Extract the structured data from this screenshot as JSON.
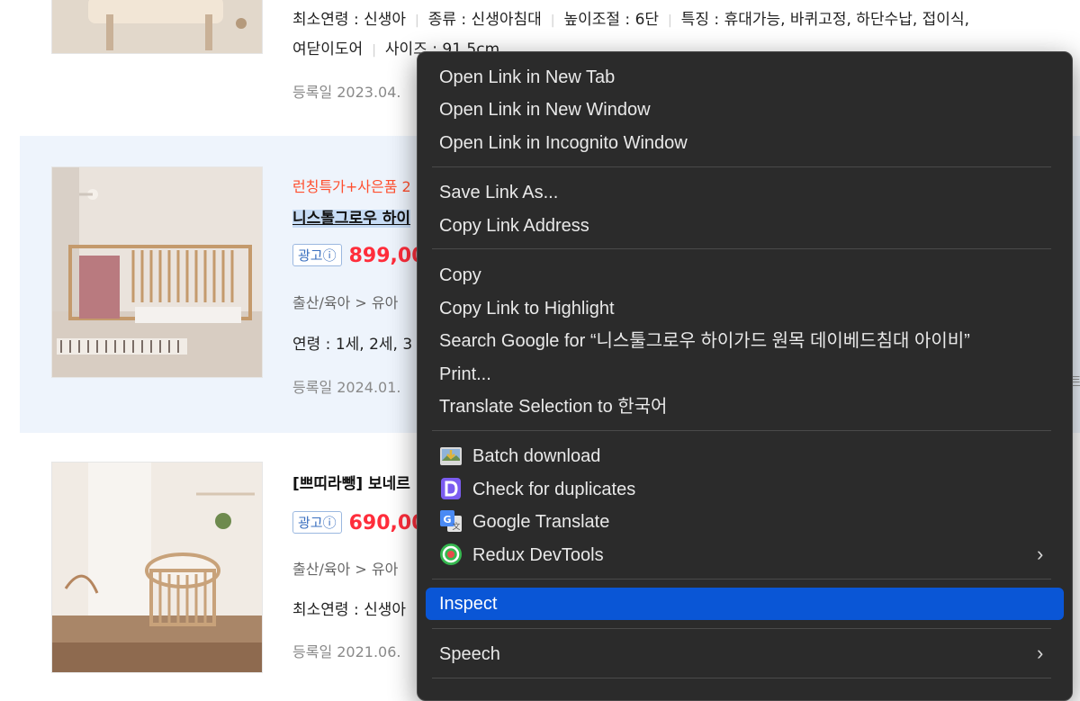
{
  "items": [
    {
      "specs": [
        "최소연령 : 신생아",
        "종류 : 신생아침대",
        "높이조절 : 6단",
        "특징 : 휴대가능, 바퀴고정, 하단수납, 접이식,"
      ],
      "specs2": [
        "여닫이도어",
        "사이즈 : 91.5cm"
      ],
      "registered": "등록일 2023.04."
    },
    {
      "promo": "런칭특가+사은품 2",
      "title": "니스톨그로우 하이",
      "ad_label": "광고ⓘ",
      "price": "899,00",
      "category": "출산/육아 > 유아",
      "specs": "연령 : 1세, 2세, 3",
      "registered": "등록일 2024.01."
    },
    {
      "title": "[쁘띠라뺑] 보네르",
      "ad_label": "광고ⓘ",
      "price": "690,00",
      "category": "출산/육아 > 유아",
      "specs": "최소연령 : 신생아",
      "registered": "등록일 2021.06."
    }
  ],
  "side_text": "트",
  "context_menu": {
    "items": [
      {
        "label": "Open Link in New Tab"
      },
      {
        "label": "Open Link in New Window"
      },
      {
        "label": "Open Link in Incognito Window"
      },
      {
        "label": "Save Link As..."
      },
      {
        "label": "Copy Link Address"
      },
      {
        "label": "Copy"
      },
      {
        "label": "Copy Link to Highlight"
      },
      {
        "label": "Search Google for “니스툴그로우 하이가드 원목 데이베드침대 아이비”"
      },
      {
        "label": "Print..."
      },
      {
        "label": "Translate Selection to 한국어"
      },
      {
        "label": "Batch download",
        "icon": "batch-download-icon"
      },
      {
        "label": "Check for duplicates",
        "icon": "duplicates-d-icon"
      },
      {
        "label": "Google Translate",
        "icon": "google-translate-icon"
      },
      {
        "label": "Redux DevTools",
        "icon": "redux-devtools-icon",
        "submenu": true
      },
      {
        "label": "Inspect",
        "active": true
      },
      {
        "label": "Speech",
        "submenu": true
      }
    ],
    "active_color": "#0a56d6"
  }
}
